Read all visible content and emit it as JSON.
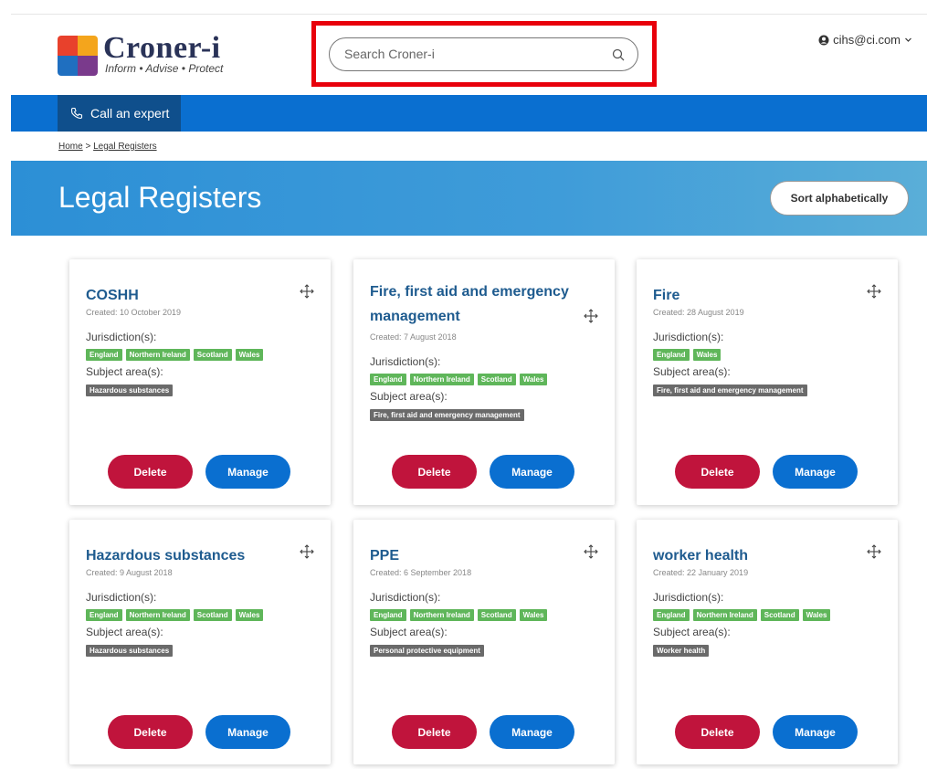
{
  "brand": {
    "name": "Croner-i",
    "tagline": "Inform • Advise • Protect",
    "colors": {
      "red": "#e8412c",
      "yellow": "#f4a51c",
      "blue": "#1f6fc0",
      "purple": "#7a3a8c"
    }
  },
  "search": {
    "placeholder": "Search Croner-i",
    "value": ""
  },
  "account": {
    "email": "cihs@ci.com"
  },
  "nav": {
    "call_label": "Call an expert"
  },
  "breadcrumb": {
    "home": "Home",
    "separator": ">",
    "current": "Legal Registers"
  },
  "page": {
    "title": "Legal Registers",
    "sort_label": "Sort alphabetically"
  },
  "labels": {
    "jurisdiction": "Jurisdiction(s):",
    "subject": "Subject area(s):",
    "delete": "Delete",
    "manage": "Manage"
  },
  "cards": [
    {
      "title": "COSHH",
      "created": "Created: 10 October 2019",
      "jurisdictions": [
        "England",
        "Northern Ireland",
        "Scotland",
        "Wales"
      ],
      "subjects": [
        "Hazardous substances"
      ]
    },
    {
      "title": "Fire, first aid and emergency management",
      "created": "Created: 7 August 2018",
      "jurisdictions": [
        "England",
        "Northern Ireland",
        "Scotland",
        "Wales"
      ],
      "subjects": [
        "Fire, first aid and emergency management"
      ]
    },
    {
      "title": "Fire",
      "created": "Created: 28 August 2019",
      "jurisdictions": [
        "England",
        "Wales"
      ],
      "subjects": [
        "Fire, first aid and emergency management"
      ]
    },
    {
      "title": "Hazardous substances",
      "created": "Created: 9 August 2018",
      "jurisdictions": [
        "England",
        "Northern Ireland",
        "Scotland",
        "Wales"
      ],
      "subjects": [
        "Hazardous substances"
      ]
    },
    {
      "title": "PPE",
      "created": "Created: 6 September 2018",
      "jurisdictions": [
        "England",
        "Northern Ireland",
        "Scotland",
        "Wales"
      ],
      "subjects": [
        "Personal protective equipment"
      ]
    },
    {
      "title": "worker health",
      "created": "Created: 22 January 2019",
      "jurisdictions": [
        "England",
        "Northern Ireland",
        "Scotland",
        "Wales"
      ],
      "subjects": [
        "Worker health"
      ]
    }
  ]
}
